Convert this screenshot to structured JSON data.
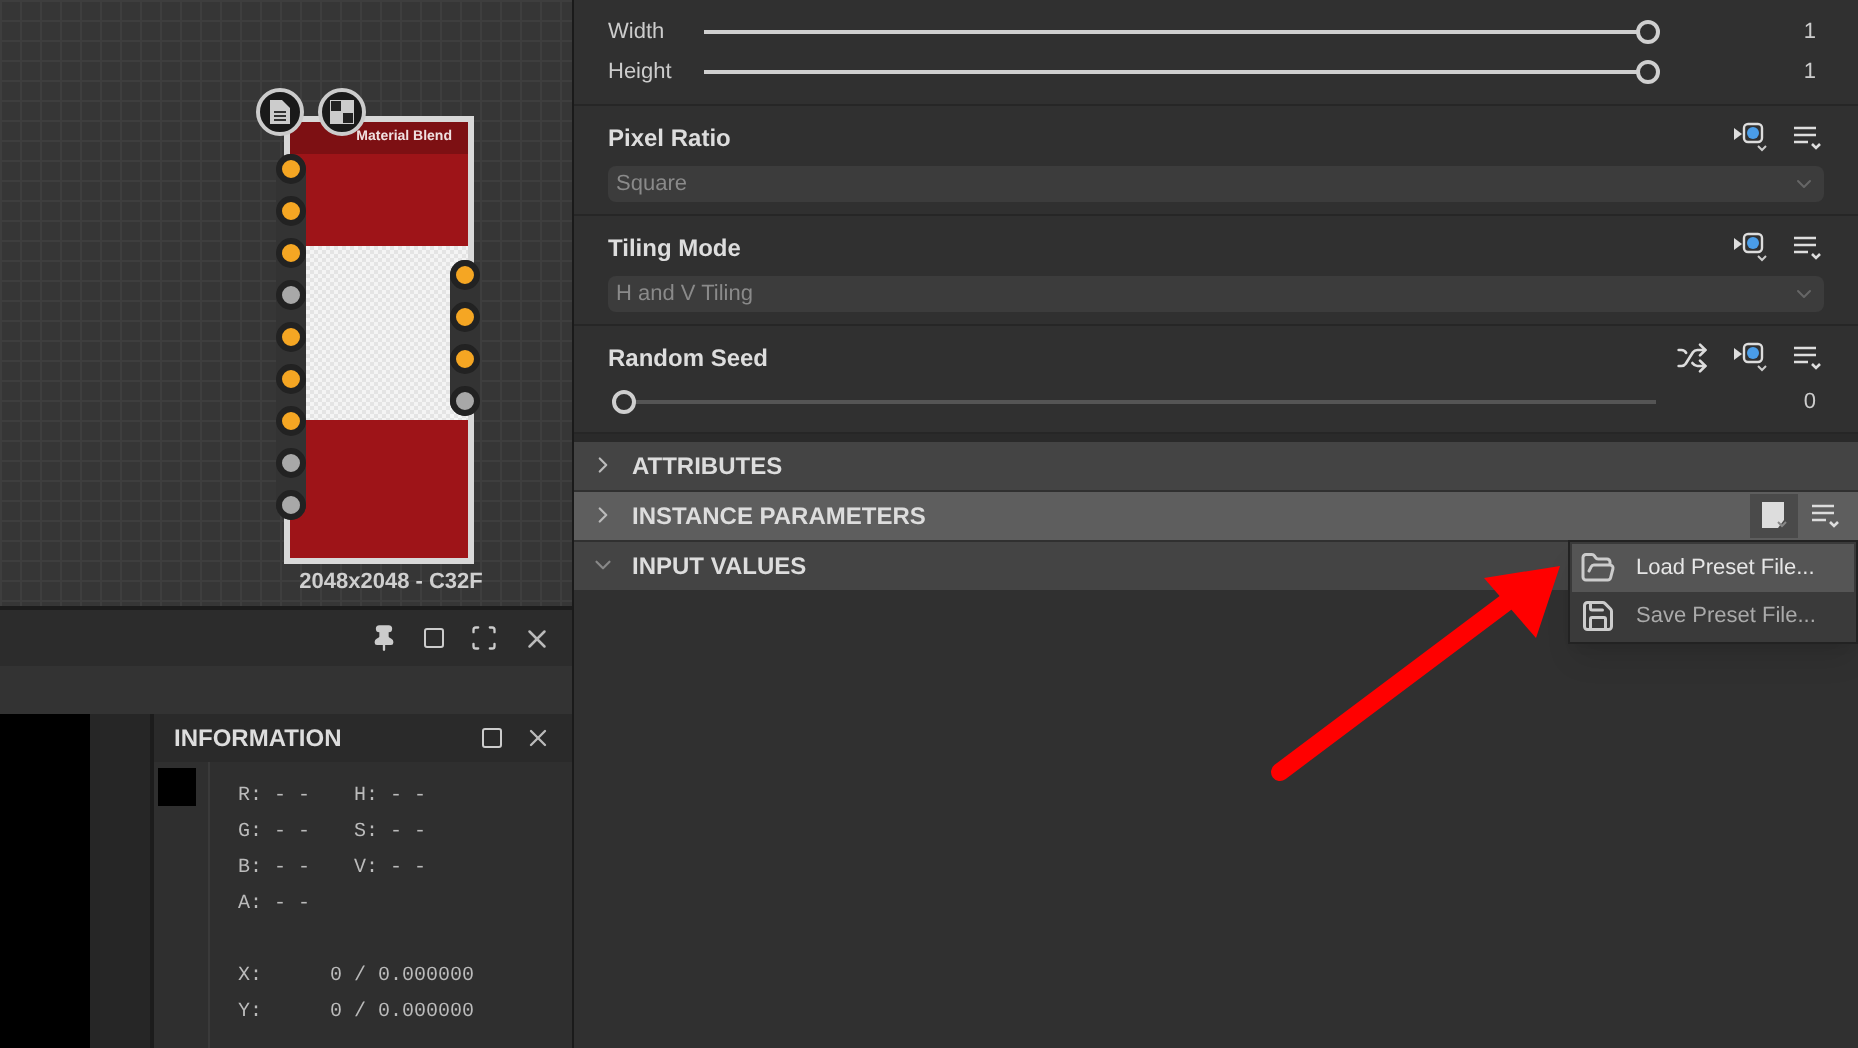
{
  "graph": {
    "node": {
      "title": "Material Blend",
      "caption": "2048x2048 - C32F",
      "inputs": [
        {
          "color": "#f5a623"
        },
        {
          "color": "#f5a623"
        },
        {
          "color": "#f5a623"
        },
        {
          "color": "#a8a8a8"
        },
        {
          "color": "#f5a623"
        },
        {
          "color": "#f5a623"
        },
        {
          "color": "#f5a623"
        },
        {
          "color": "#a8a8a8"
        },
        {
          "color": "#a8a8a8"
        }
      ],
      "outputs": [
        {
          "color": "#f5a623"
        },
        {
          "color": "#f5a623"
        },
        {
          "color": "#f5a623"
        },
        {
          "color": "#a8a8a8"
        }
      ]
    }
  },
  "information": {
    "title": "INFORMATION",
    "color_rows": [
      {
        "left": "R: - -",
        "right": "H: - -"
      },
      {
        "left": "G: - -",
        "right": "S: - -"
      },
      {
        "left": "B: - -",
        "right": "V: - -"
      },
      {
        "left": "A: - -"
      }
    ],
    "coords": [
      {
        "label": "X:",
        "value": "0 / 0.000000"
      },
      {
        "label": "Y:",
        "value": "0 / 0.000000"
      }
    ]
  },
  "size_sliders": [
    {
      "label": "Width",
      "level": 1,
      "reading": "1"
    },
    {
      "label": "Height",
      "level": 1,
      "reading": "1"
    }
  ],
  "params": [
    {
      "label": "Pixel Ratio",
      "kind": "dropdown",
      "value": "Square",
      "disabled": true
    },
    {
      "label": "Tiling Mode",
      "kind": "dropdown",
      "value": "H and V Tiling",
      "disabled": true
    },
    {
      "label": "Random Seed",
      "kind": "slider",
      "level": 0,
      "reading": "0"
    }
  ],
  "sections": [
    {
      "label": "ATTRIBUTES",
      "expanded": false,
      "highlighted": false
    },
    {
      "label": "INSTANCE PARAMETERS",
      "expanded": false,
      "highlighted": true
    },
    {
      "label": "INPUT VALUES",
      "expanded": true,
      "highlighted": false
    }
  ],
  "preset_menu": [
    {
      "label": "Load Preset File...",
      "kind": "load",
      "selected": true
    },
    {
      "label": "Save Preset File...",
      "kind": "save",
      "selected": false
    }
  ]
}
